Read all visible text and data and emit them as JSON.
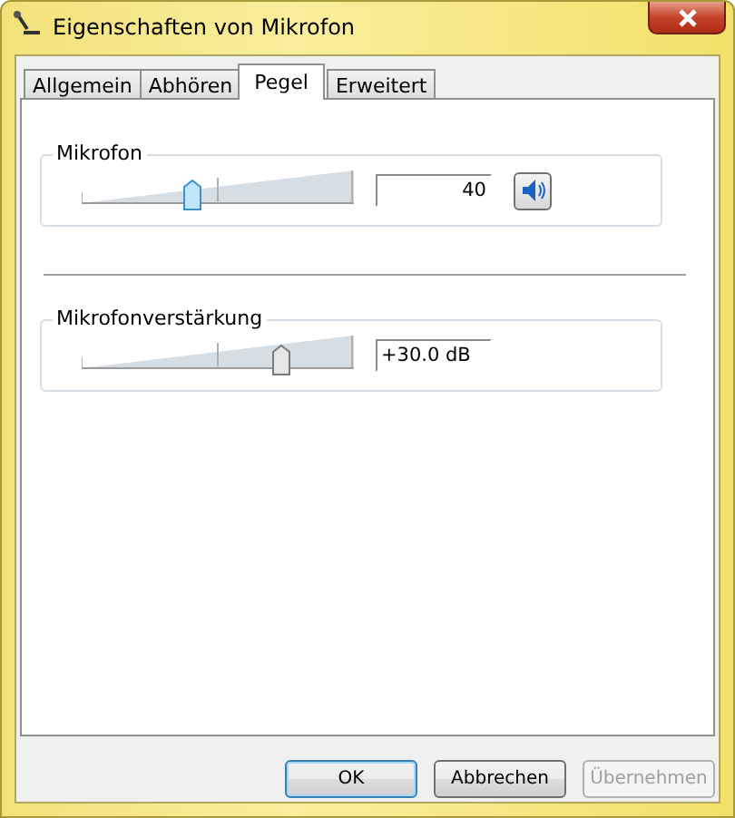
{
  "window": {
    "title": "Eigenschaften von Mikrofon"
  },
  "tabs": [
    {
      "label": "Allgemein",
      "selected": false
    },
    {
      "label": "Abhören",
      "selected": false
    },
    {
      "label": "Pegel",
      "selected": true
    },
    {
      "label": "Erweitert",
      "selected": false
    }
  ],
  "groups": [
    {
      "title": "Mikrofon",
      "level": 0.4,
      "focused": true,
      "reading": "40",
      "mute_button": {
        "muted": false
      }
    },
    {
      "title": "Mikrofonverstärkung",
      "level": 0.75,
      "focused": false,
      "reading": "+30.0 dB"
    }
  ],
  "buttons": [
    {
      "label": "OK",
      "default": true,
      "disabled": false
    },
    {
      "label": "Abbrechen",
      "default": false,
      "disabled": false
    },
    {
      "label": "Übernehmen",
      "default": false,
      "disabled": true
    }
  ]
}
